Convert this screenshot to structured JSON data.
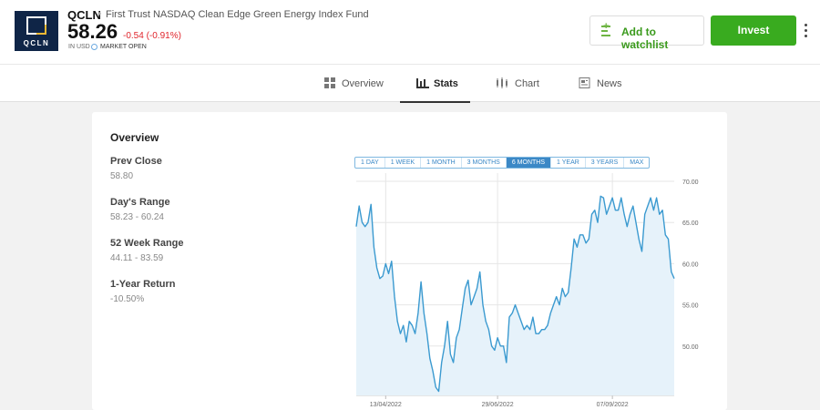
{
  "header": {
    "logo_text": "QCLN",
    "ticker": "QCLN",
    "separator": "•",
    "fund_name": "First Trust NASDAQ Clean Edge Green Energy Index Fund",
    "price": "58.26",
    "change": "-0.54 (-0.91%)",
    "currency": "IN USD",
    "market_status": "MARKET OPEN",
    "watchlist_label": "Add to watchlist",
    "invest_label": "Invest"
  },
  "tabs": [
    {
      "label": "Overview",
      "icon": "grid-icon"
    },
    {
      "label": "Stats",
      "icon": "bar-chart-icon",
      "active": true
    },
    {
      "label": "Chart",
      "icon": "candlestick-icon"
    },
    {
      "label": "News",
      "icon": "newspaper-icon"
    }
  ],
  "overview": {
    "title": "Overview",
    "stats": [
      {
        "label": "Prev Close",
        "value": "58.80"
      },
      {
        "label": "Day's Range",
        "value": "58.23 - 60.24"
      },
      {
        "label": "52 Week Range",
        "value": "44.11 - 83.59"
      },
      {
        "label": "1-Year Return",
        "value": "-10.50%"
      }
    ]
  },
  "ranges": [
    "1 DAY",
    "1 WEEK",
    "1 MONTH",
    "3 MONTHS",
    "6 MONTHS",
    "1 YEAR",
    "3 YEARS",
    "MAX"
  ],
  "active_range": "6 MONTHS",
  "colors": {
    "accent_green": "#39ab1f",
    "negative_red": "#e0242b",
    "chart_line": "#3b9ad0",
    "chart_fill": "#e6f2fa"
  },
  "chart_data": {
    "type": "area",
    "y_ticks": [
      "70.00",
      "65.00",
      "60.00",
      "55.00",
      "50.00"
    ],
    "y_tick_values": [
      70,
      65,
      60,
      55,
      50
    ],
    "x_ticks": [
      "13/04/2022",
      "29/06/2022",
      "07/09/2022"
    ],
    "x_tick_index": [
      10,
      48,
      87
    ],
    "ylim": [
      44,
      71
    ],
    "grid": true,
    "values": [
      64.5,
      67,
      65,
      64.5,
      65,
      67.2,
      62,
      59.5,
      58.2,
      58.5,
      60,
      58.8,
      60.3,
      56,
      53,
      51.5,
      52.5,
      50.5,
      53,
      52.5,
      51.5,
      54,
      57.8,
      54,
      51.5,
      48.5,
      47,
      45,
      44.5,
      48,
      50,
      53,
      49,
      48,
      51,
      52,
      54.5,
      57,
      58,
      55,
      56,
      57,
      59,
      55,
      53,
      52,
      50,
      49.5,
      51,
      50,
      50,
      48,
      53.5,
      54,
      55,
      54,
      53,
      52,
      52.5,
      52,
      53.5,
      51.5,
      51.5,
      52,
      52,
      52.5,
      54,
      55,
      56,
      55,
      57,
      56,
      56.5,
      59.5,
      63,
      62,
      63.5,
      63.5,
      62.5,
      63,
      66,
      66.5,
      65,
      68.2,
      68,
      66,
      67,
      68,
      66.5,
      66.5,
      68,
      66,
      64.5,
      66,
      67,
      65,
      63,
      61.5,
      66,
      67,
      68,
      66.5,
      68,
      66,
      66.5,
      63.5,
      63,
      59,
      58.2
    ]
  }
}
